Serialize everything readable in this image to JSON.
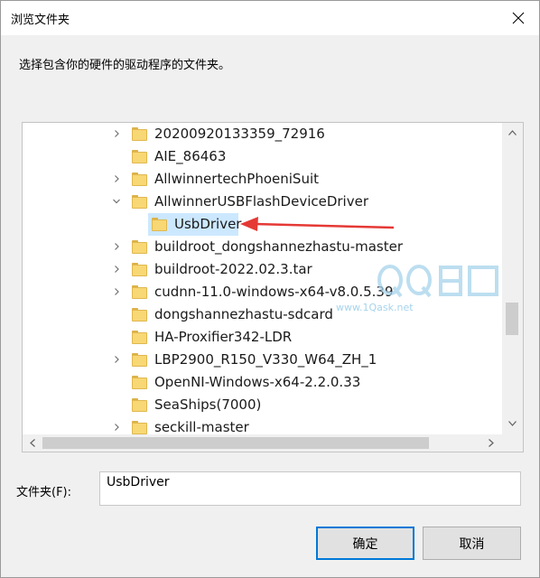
{
  "window": {
    "title": "浏览文件夹",
    "close_icon": "close-icon"
  },
  "instruction": "选择包含你的硬件的驱动程序的文件夹。",
  "tree": {
    "items": [
      {
        "label": "20200920133359_72916",
        "level": 0,
        "expander": "collapsed"
      },
      {
        "label": "AIE_86463",
        "level": 0,
        "expander": "none"
      },
      {
        "label": "AllwinnertechPhoeniSuit",
        "level": 0,
        "expander": "collapsed"
      },
      {
        "label": "AllwinnerUSBFlashDeviceDriver",
        "level": 0,
        "expander": "expanded"
      },
      {
        "label": "UsbDriver",
        "level": 1,
        "expander": "none",
        "selected": true
      },
      {
        "label": "buildroot_dongshannezhastu-master",
        "level": 0,
        "expander": "collapsed"
      },
      {
        "label": "buildroot-2022.02.3.tar",
        "level": 0,
        "expander": "collapsed"
      },
      {
        "label": "cudnn-11.0-windows-x64-v8.0.5.39",
        "level": 0,
        "expander": "collapsed"
      },
      {
        "label": "dongshannezhastu-sdcard",
        "level": 0,
        "expander": "none"
      },
      {
        "label": "HA-Proxifier342-LDR",
        "level": 0,
        "expander": "none"
      },
      {
        "label": "LBP2900_R150_V330_W64_ZH_1",
        "level": 0,
        "expander": "collapsed"
      },
      {
        "label": "OpenNI-Windows-x64-2.2.0.33",
        "level": 0,
        "expander": "none"
      },
      {
        "label": "SeaShips(7000)",
        "level": 0,
        "expander": "none"
      },
      {
        "label": "seckill-master",
        "level": 0,
        "expander": "collapsed"
      }
    ]
  },
  "folder_field": {
    "label": "文件夹(F):",
    "value": "UsbDriver"
  },
  "buttons": {
    "ok": "确定",
    "cancel": "取消"
  },
  "watermark": {
    "text": "www.1Qask.net"
  },
  "colors": {
    "selection": "#cce8ff",
    "annotation_arrow": "#e53935",
    "focus_border": "#0078d7"
  }
}
